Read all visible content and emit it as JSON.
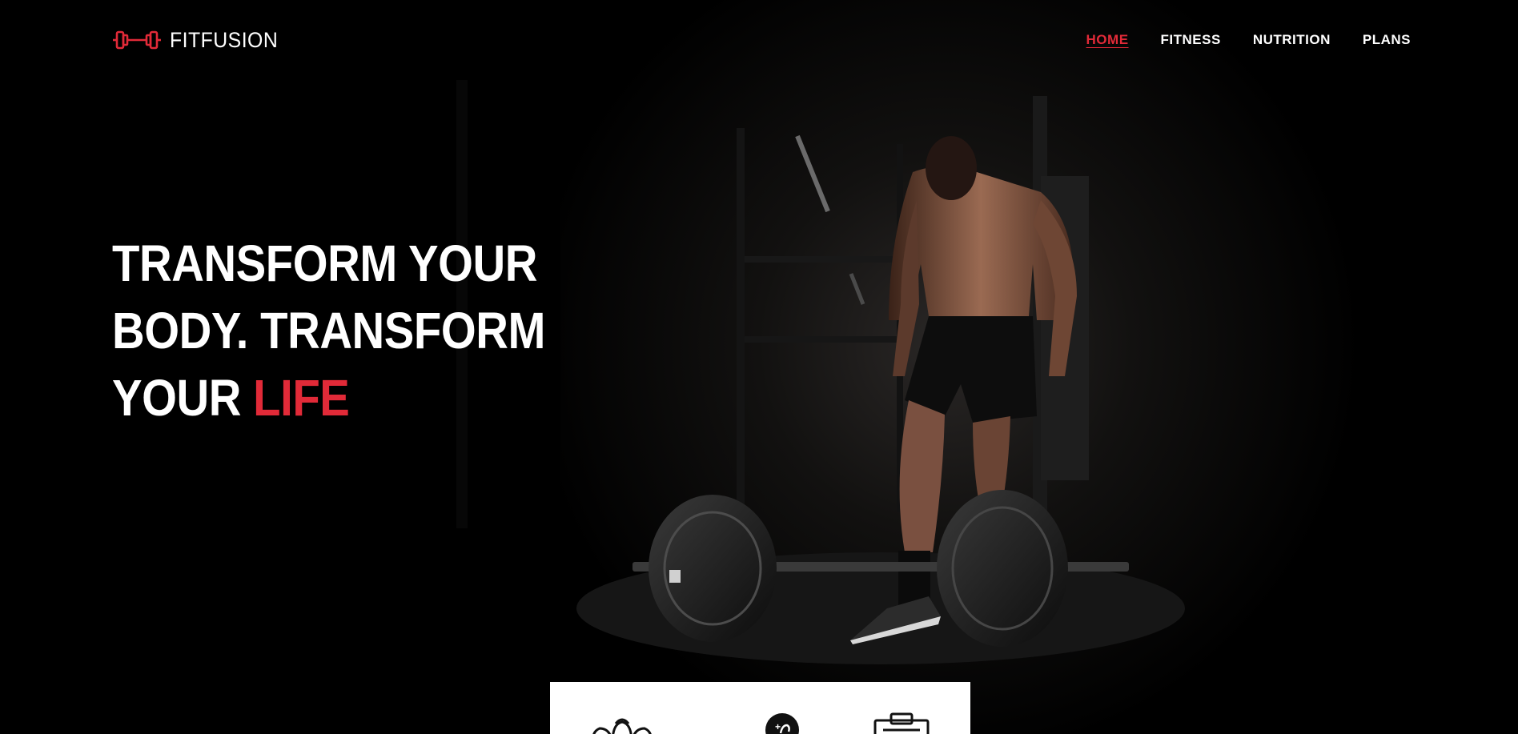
{
  "brand": {
    "name": "FITFUSION",
    "logo_icon": "dumbbell-icon",
    "accent_color": "#e12a38"
  },
  "nav": {
    "items": [
      {
        "label": "HOME",
        "active": true
      },
      {
        "label": "FITNESS",
        "active": false
      },
      {
        "label": "NUTRITION",
        "active": false
      },
      {
        "label": "PLANS",
        "active": false
      }
    ]
  },
  "hero": {
    "line1": "TRANSFORM YOUR",
    "line2": "BODY. TRANSFORM",
    "line3_prefix": "YOUR ",
    "line3_accent": "LIFE",
    "background": "dark gym photo with athlete standing over a barbell"
  },
  "features": {
    "icons": [
      "trainer-icon",
      "muscle-badge-icon",
      "clipboard-icon"
    ]
  }
}
